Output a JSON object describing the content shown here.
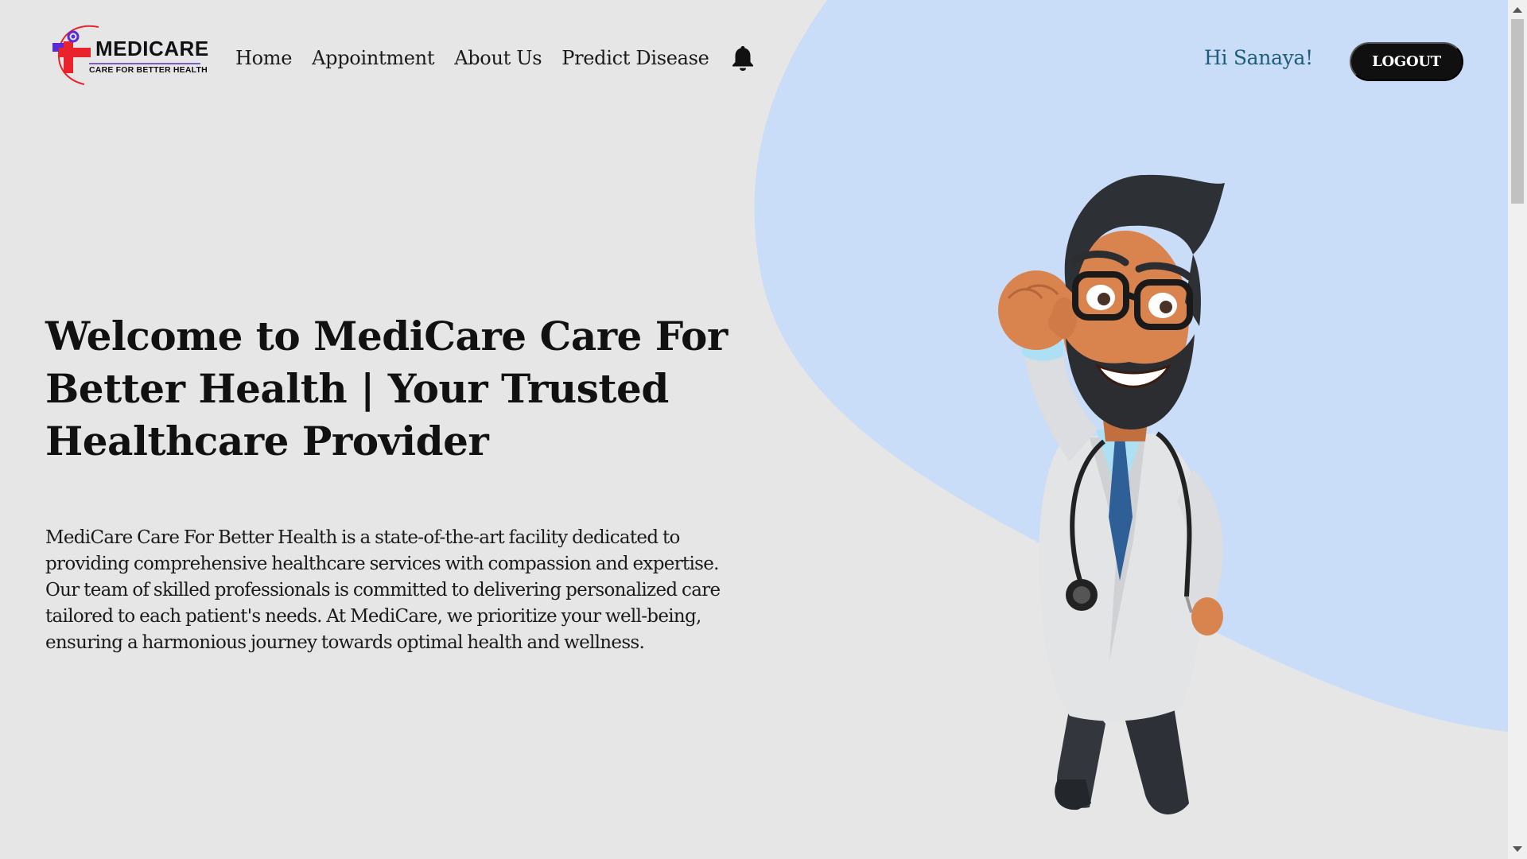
{
  "logo": {
    "word": "MEDICARE",
    "tagline": "CARE FOR BETTER HEALTH",
    "icon": "medical-cross-logo-icon"
  },
  "nav": {
    "items": [
      {
        "label": "Home"
      },
      {
        "label": "Appointment"
      },
      {
        "label": "About Us"
      },
      {
        "label": "Predict Disease"
      }
    ],
    "notification_icon": "bell-icon"
  },
  "user": {
    "greeting": "Hi Sanaya!",
    "logout_label": "LOGOUT"
  },
  "hero": {
    "title": "Welcome to MediCare Care For Better Health | Your Trusted Healthcare Provider",
    "description": "MediCare Care For Better Health is a state-of-the-art facility dedicated to providing comprehensive healthcare services with compassion and expertise. Our team of skilled professionals is committed to delivering personalized care tailored to each patient's needs. At MediCare, we prioritize your well-being, ensuring a harmonious journey towards optimal health and wellness.",
    "illustration": "cartoon-doctor-illustration"
  },
  "colors": {
    "background": "#e6e6e6",
    "blob": "#c9dcf8",
    "greeting": "#1d5d7a",
    "button": "#101010",
    "logo_red": "#e8232c",
    "logo_purple": "#5b2bd6"
  }
}
